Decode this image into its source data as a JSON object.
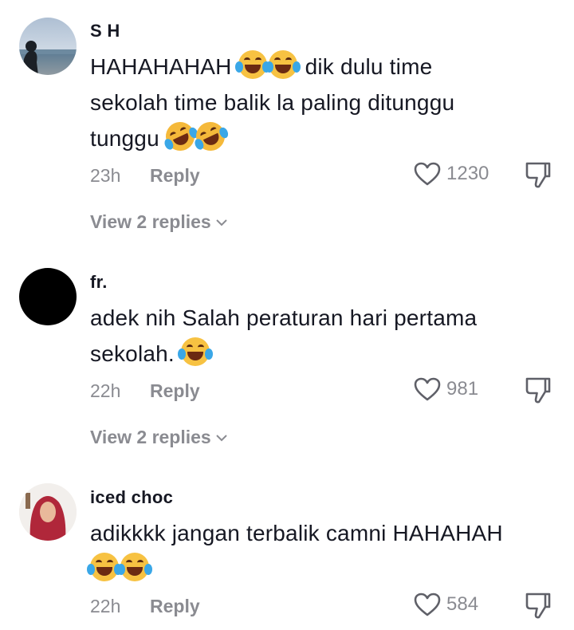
{
  "comments": [
    {
      "username": "S H",
      "text": "HAHAHAHAH",
      "text_after_emojis": "dik dulu time",
      "line2": "sekolah time balik la paling ditunggu",
      "line3": "tunggu",
      "time": "23h",
      "reply_label": "Reply",
      "likes": "1230",
      "view_replies": "View 2 replies"
    },
    {
      "username": "fr.",
      "text": "adek nih Salah peraturan hari pertama",
      "line2": "sekolah.",
      "time": "22h",
      "reply_label": "Reply",
      "likes": "981",
      "view_replies": "View 2 replies"
    },
    {
      "username": "iced choc",
      "text": "adikkkk jangan terbalik camni HAHAHAH",
      "time": "22h",
      "reply_label": "Reply",
      "likes": "584"
    }
  ],
  "icons": {
    "like": "heart-outline-icon",
    "dislike": "thumbs-down-icon",
    "emoji_joy": "face-with-tears-of-joy",
    "emoji_rofl": "rolling-on-the-floor-laughing",
    "chevron": "chevron-down-icon"
  },
  "colors": {
    "text": "#161823",
    "muted": "#8a8b91",
    "background": "#ffffff"
  }
}
